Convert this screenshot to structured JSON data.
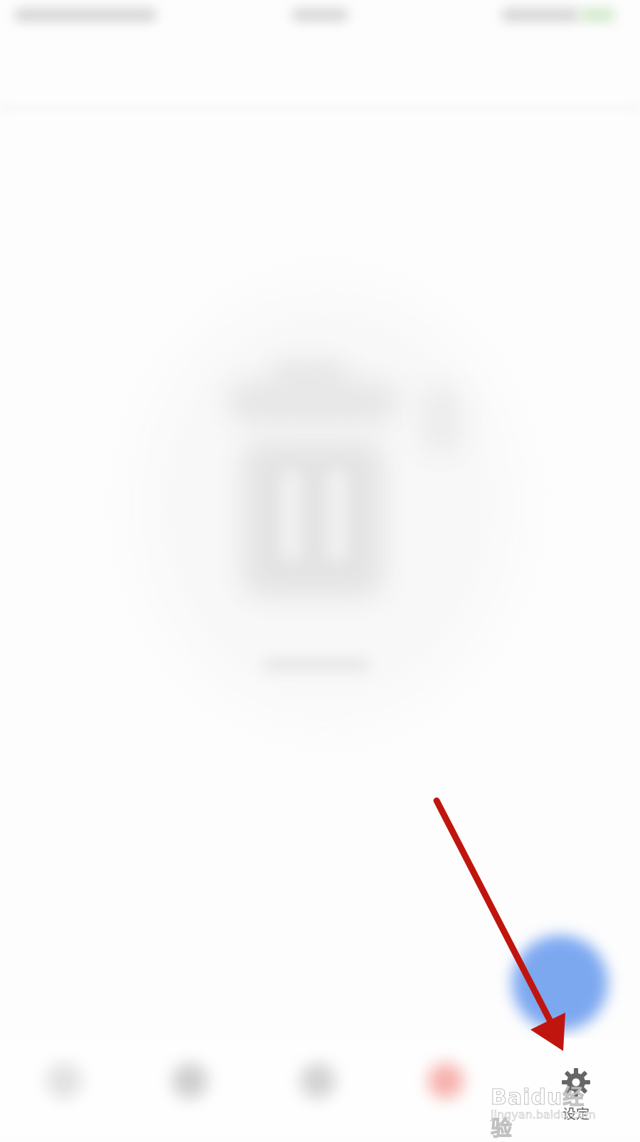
{
  "bottom_nav": {
    "settings_label": "设定"
  },
  "watermark": {
    "brand": "Baidu经验",
    "url": "jingyan.baidu.com"
  },
  "colors": {
    "fab": "#6f9fef",
    "annotation_arrow": "#c0150e",
    "nav_label": "#555555",
    "gear": "#666666"
  },
  "icons": {
    "empty_state": "trash-icon",
    "settings": "gear-icon",
    "annotation": "arrow-icon"
  }
}
